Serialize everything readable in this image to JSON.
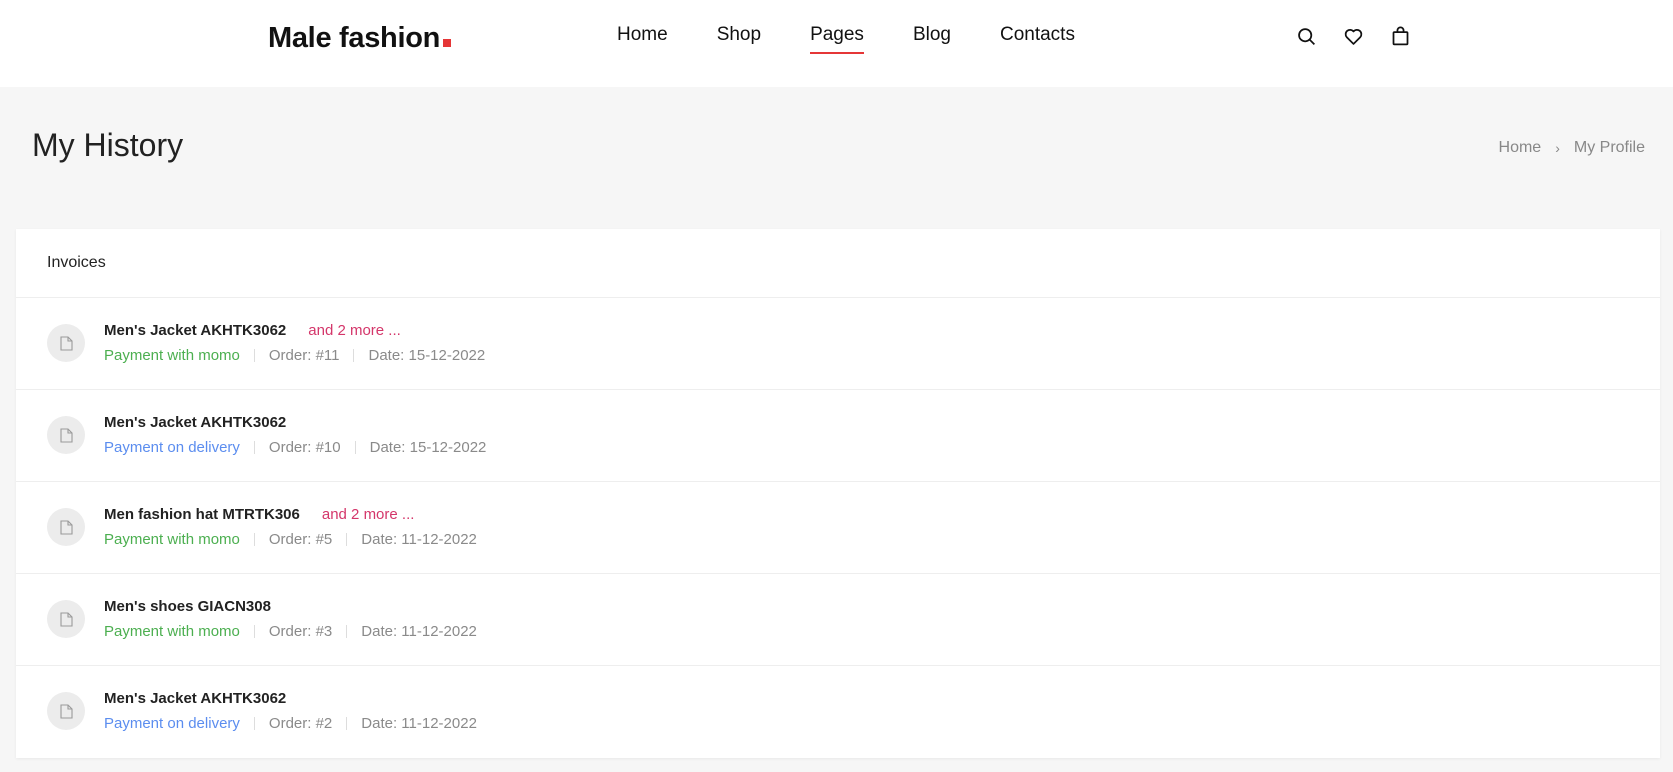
{
  "header": {
    "logo_text": "Male fashion",
    "nav": [
      {
        "label": "Home",
        "active": false
      },
      {
        "label": "Shop",
        "active": false
      },
      {
        "label": "Pages",
        "active": true
      },
      {
        "label": "Blog",
        "active": false
      },
      {
        "label": "Contacts",
        "active": false
      }
    ],
    "icons": [
      "search-icon",
      "heart-icon",
      "shopping-bag-icon"
    ],
    "accent_color": "#e53637"
  },
  "page": {
    "title": "My History",
    "breadcrumb": [
      "Home",
      "My Profile"
    ]
  },
  "invoices": {
    "heading": "Invoices",
    "items": [
      {
        "title": "Men's Jacket AKHTK3062",
        "more": "and 2 more ...",
        "payment": "Payment with momo",
        "payment_type": "momo",
        "order": "Order: #11",
        "date": "Date: 15-12-2022"
      },
      {
        "title": "Men's Jacket AKHTK3062",
        "more": "",
        "payment": "Payment on delivery",
        "payment_type": "delivery",
        "order": "Order: #10",
        "date": "Date: 15-12-2022"
      },
      {
        "title": "Men fashion hat MTRTK306",
        "more": "and 2 more ...",
        "payment": "Payment with momo",
        "payment_type": "momo",
        "order": "Order: #5",
        "date": "Date: 11-12-2022"
      },
      {
        "title": "Men's shoes GIACN308",
        "more": "",
        "payment": "Payment with momo",
        "payment_type": "momo",
        "order": "Order: #3",
        "date": "Date: 11-12-2022"
      },
      {
        "title": "Men's Jacket AKHTK3062",
        "more": "",
        "payment": "Payment on delivery",
        "payment_type": "delivery",
        "order": "Order: #2",
        "date": "Date: 11-12-2022"
      }
    ],
    "colors": {
      "momo": "#4caf50",
      "delivery": "#5b8def",
      "more": "#d4366a"
    }
  }
}
